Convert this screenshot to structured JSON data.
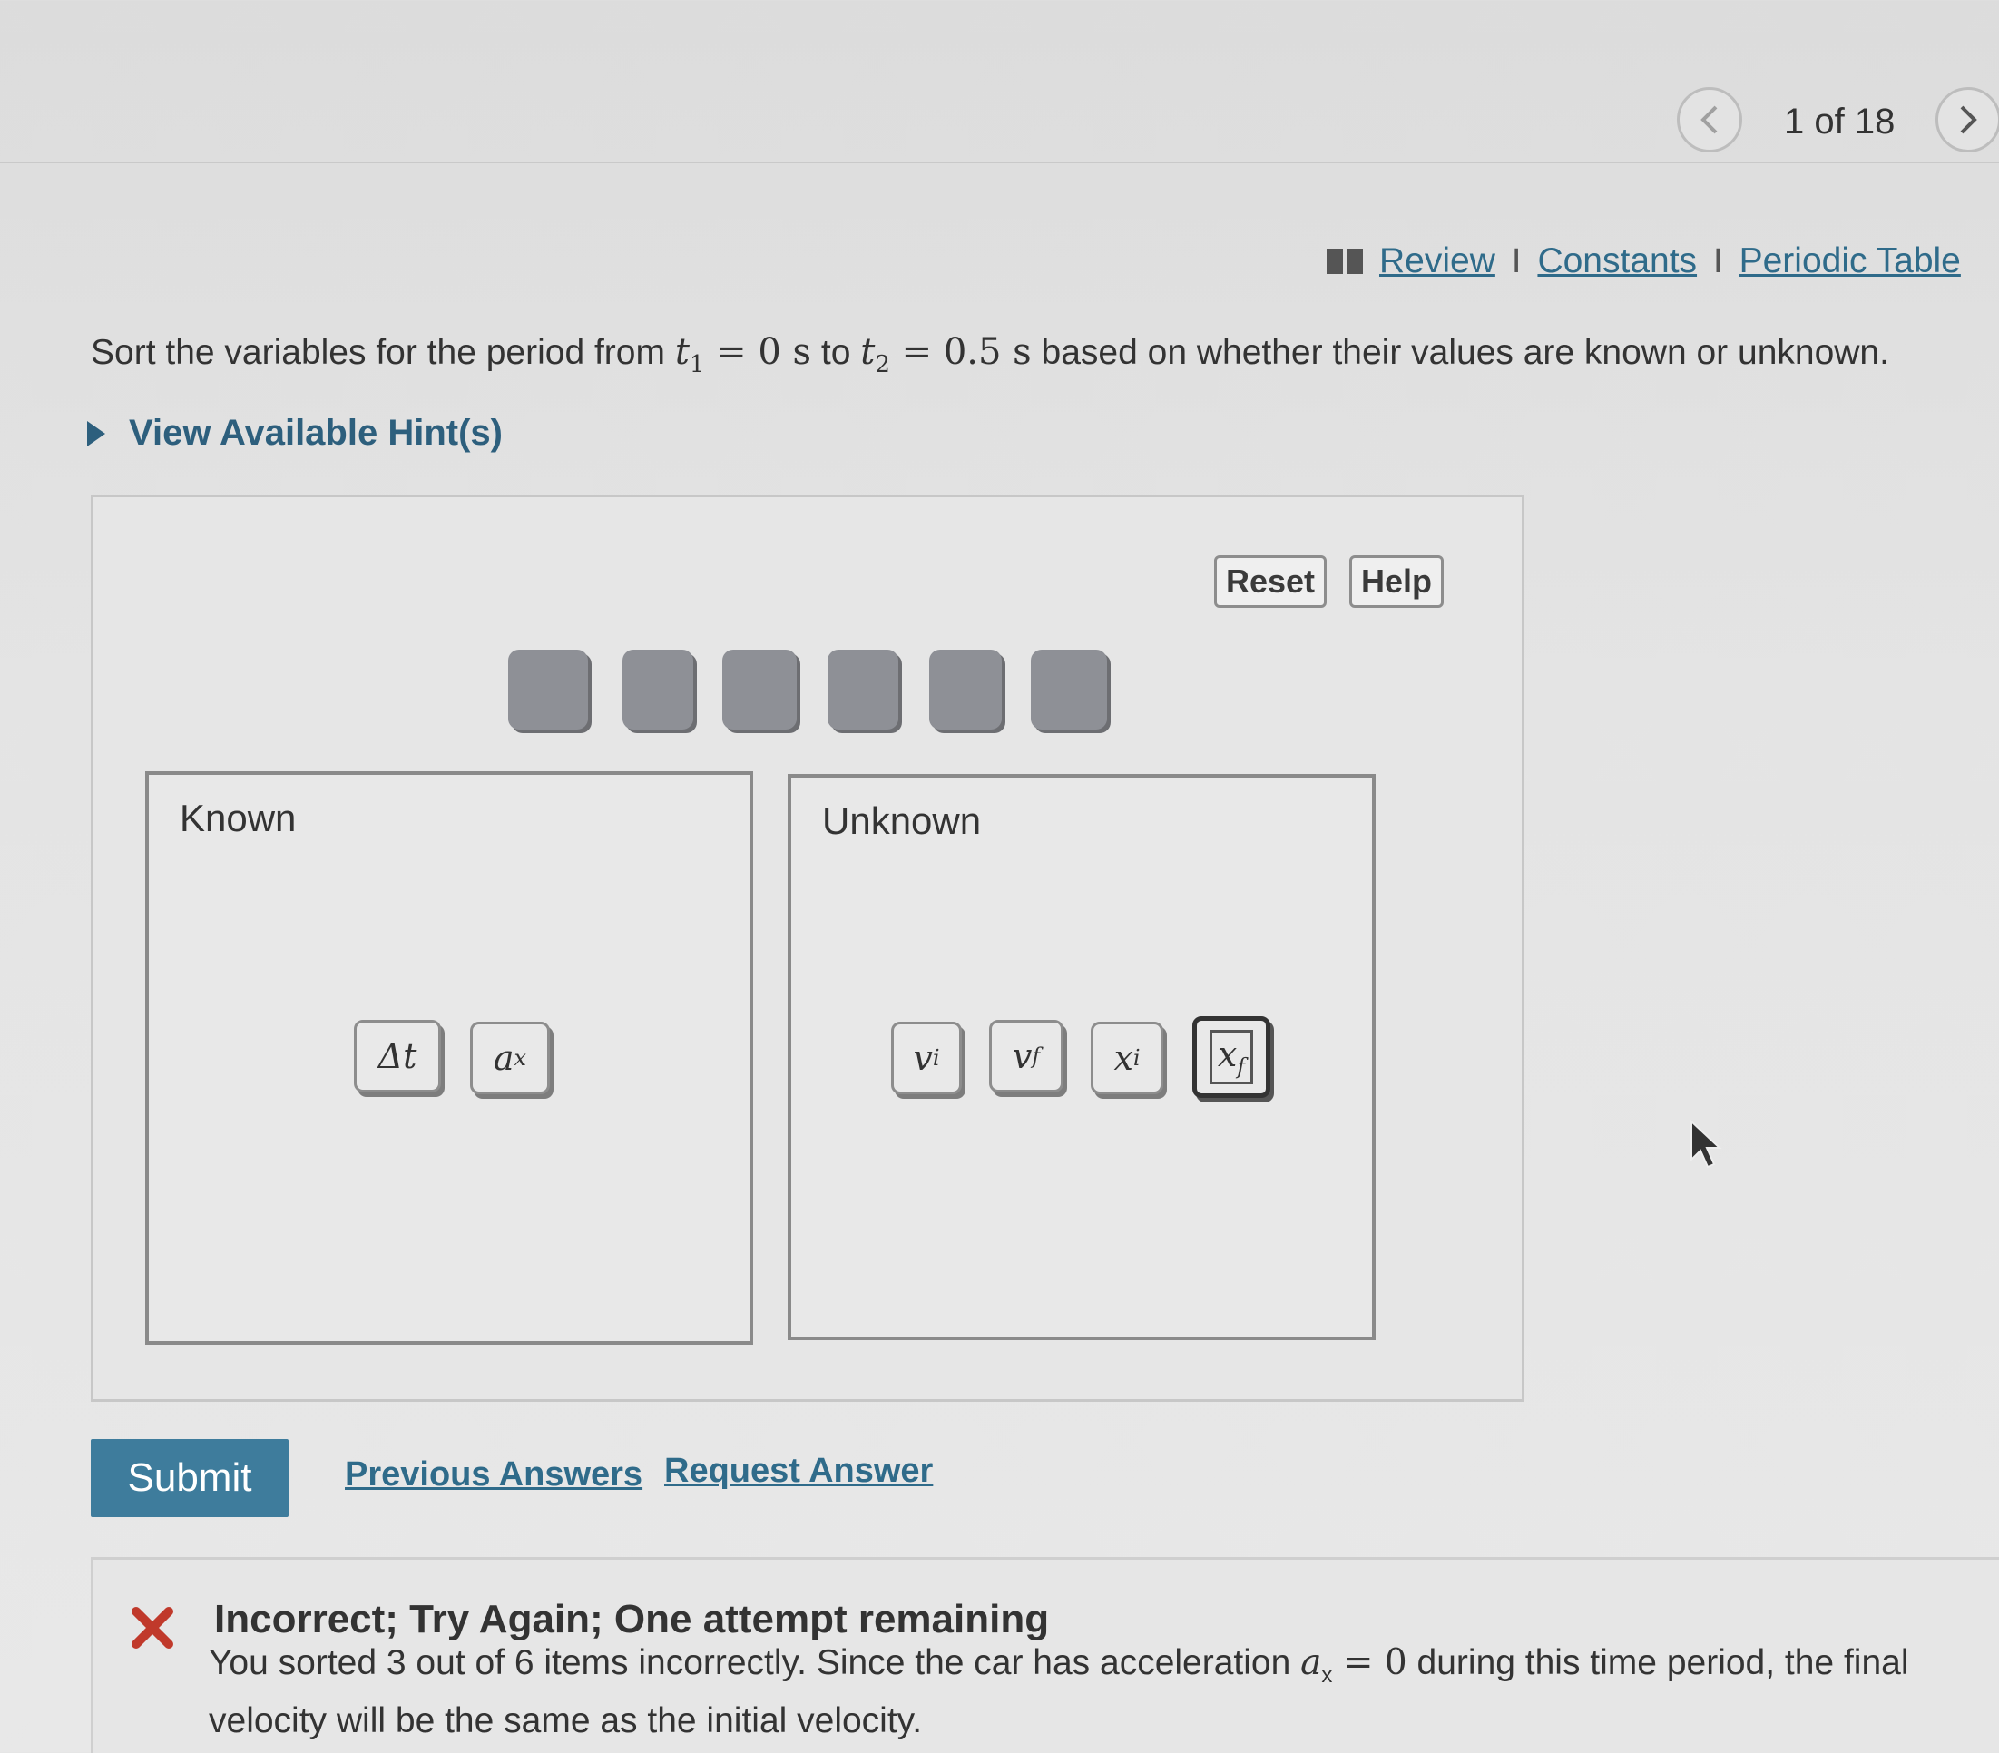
{
  "pagination": {
    "counter": "1 of 18"
  },
  "links": {
    "review": "Review",
    "constants": "Constants",
    "periodic_table": "Periodic Table",
    "separator": "I"
  },
  "question": {
    "prefix": "Sort the variables for the period from ",
    "t1_sym": "t",
    "t1_sub": "1",
    "t1_val": " = 0 s",
    "mid": " to ",
    "t2_sym": "t",
    "t2_sub": "2",
    "t2_val": " = 0.5 s",
    "suffix": " based on whether their values are known or unknown."
  },
  "hint": {
    "label": "View Available Hint(s)"
  },
  "toolbar": {
    "reset_label": "Reset",
    "help_label": "Help"
  },
  "bins": {
    "known": {
      "label": "Known",
      "items": [
        {
          "sym": "Δt",
          "sub": ""
        },
        {
          "sym": "a",
          "sub": "x"
        }
      ]
    },
    "unknown": {
      "label": "Unknown",
      "items": [
        {
          "sym": "v",
          "sub": "i"
        },
        {
          "sym": "v",
          "sub": "f"
        },
        {
          "sym": "x",
          "sub": "i"
        },
        {
          "sym": "x",
          "sub": "f"
        }
      ]
    }
  },
  "actions": {
    "submit_label": "Submit",
    "previous_answers": "Previous Answers",
    "request_answer": "Request Answer"
  },
  "feedback": {
    "title": "Incorrect; Try Again; One attempt remaining",
    "text_pre": "You sorted 3 out of 6 items incorrectly. Since the car has acceleration ",
    "sym": "a",
    "sub": "x",
    "eq": " = 0",
    "text_post": " during this time period, the final velocity will be the same as the initial velocity."
  },
  "colors": {
    "accent": "#3e7c9c",
    "link": "#2f6b8a",
    "error": "#c0392b"
  }
}
